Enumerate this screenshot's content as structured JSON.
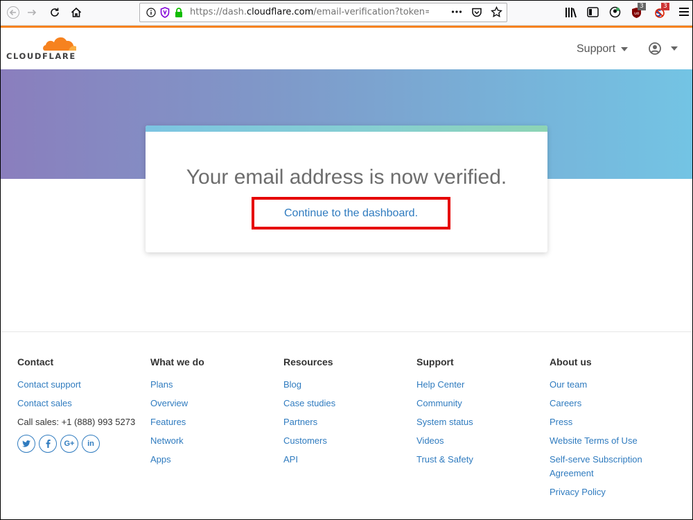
{
  "browser": {
    "url_prefix": "https://dash.",
    "url_host": "cloudflare.com",
    "url_rest": "/email-verification?token=ug",
    "extension_badge_1": "3",
    "extension_badge_2": "3"
  },
  "header": {
    "logo_text": "CLOUDFLARE",
    "support_label": "Support"
  },
  "card": {
    "title": "Your email address is now verified.",
    "continue_link": "Continue to the dashboard."
  },
  "footer": {
    "columns": [
      {
        "heading": "Contact",
        "links": [
          "Contact support",
          "Contact sales"
        ],
        "phone_text": "Call sales: +1 (888) 993 5273",
        "social": [
          "twitter-icon",
          "facebook-icon",
          "google-plus-icon",
          "linkedin-icon"
        ]
      },
      {
        "heading": "What we do",
        "links": [
          "Plans",
          "Overview",
          "Features",
          "Network",
          "Apps"
        ]
      },
      {
        "heading": "Resources",
        "links": [
          "Blog",
          "Case studies",
          "Partners",
          "Customers",
          "API"
        ]
      },
      {
        "heading": "Support",
        "links": [
          "Help Center",
          "Community",
          "System status",
          "Videos",
          "Trust & Safety"
        ]
      },
      {
        "heading": "About us",
        "links": [
          "Our team",
          "Careers",
          "Press",
          "Website Terms of Use",
          "Self-serve Subscription Agreement",
          "Privacy Policy"
        ]
      }
    ]
  },
  "colors": {
    "accent_orange": "#f6821f",
    "link_blue": "#2f7bbf",
    "highlight_red": "#e60000"
  }
}
